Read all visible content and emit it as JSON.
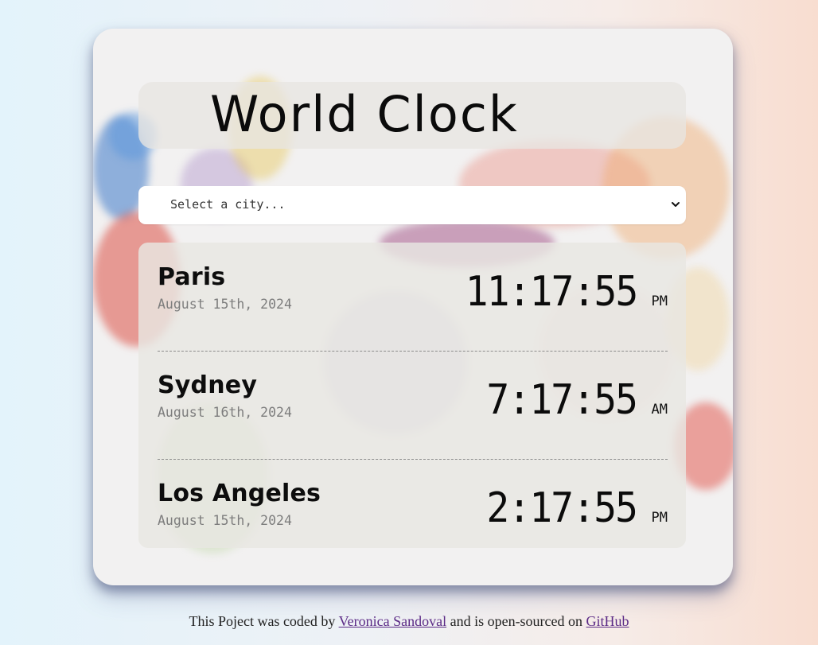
{
  "app": {
    "title": "World Clock"
  },
  "city_select": {
    "placeholder": "Select a city...",
    "icon": "chevron-down-icon"
  },
  "cities": [
    {
      "name": "Paris",
      "date": "August 15th, 2024",
      "time": "11:17:55",
      "period": "PM"
    },
    {
      "name": "Sydney",
      "date": "August 16th, 2024",
      "time": "7:17:55",
      "period": "AM"
    },
    {
      "name": "Los Angeles",
      "date": "August 15th, 2024",
      "time": "2:17:55",
      "period": "PM"
    }
  ],
  "footer": {
    "prefix": "This Poject was coded by",
    "author_link": "Veronica Sandoval",
    "middle": "and is open-sourced on",
    "repo_link": "GitHub"
  },
  "colors": {
    "card_background": "#f2f1f1",
    "link": "#5b2a86",
    "date_text": "#7d7d7d"
  }
}
